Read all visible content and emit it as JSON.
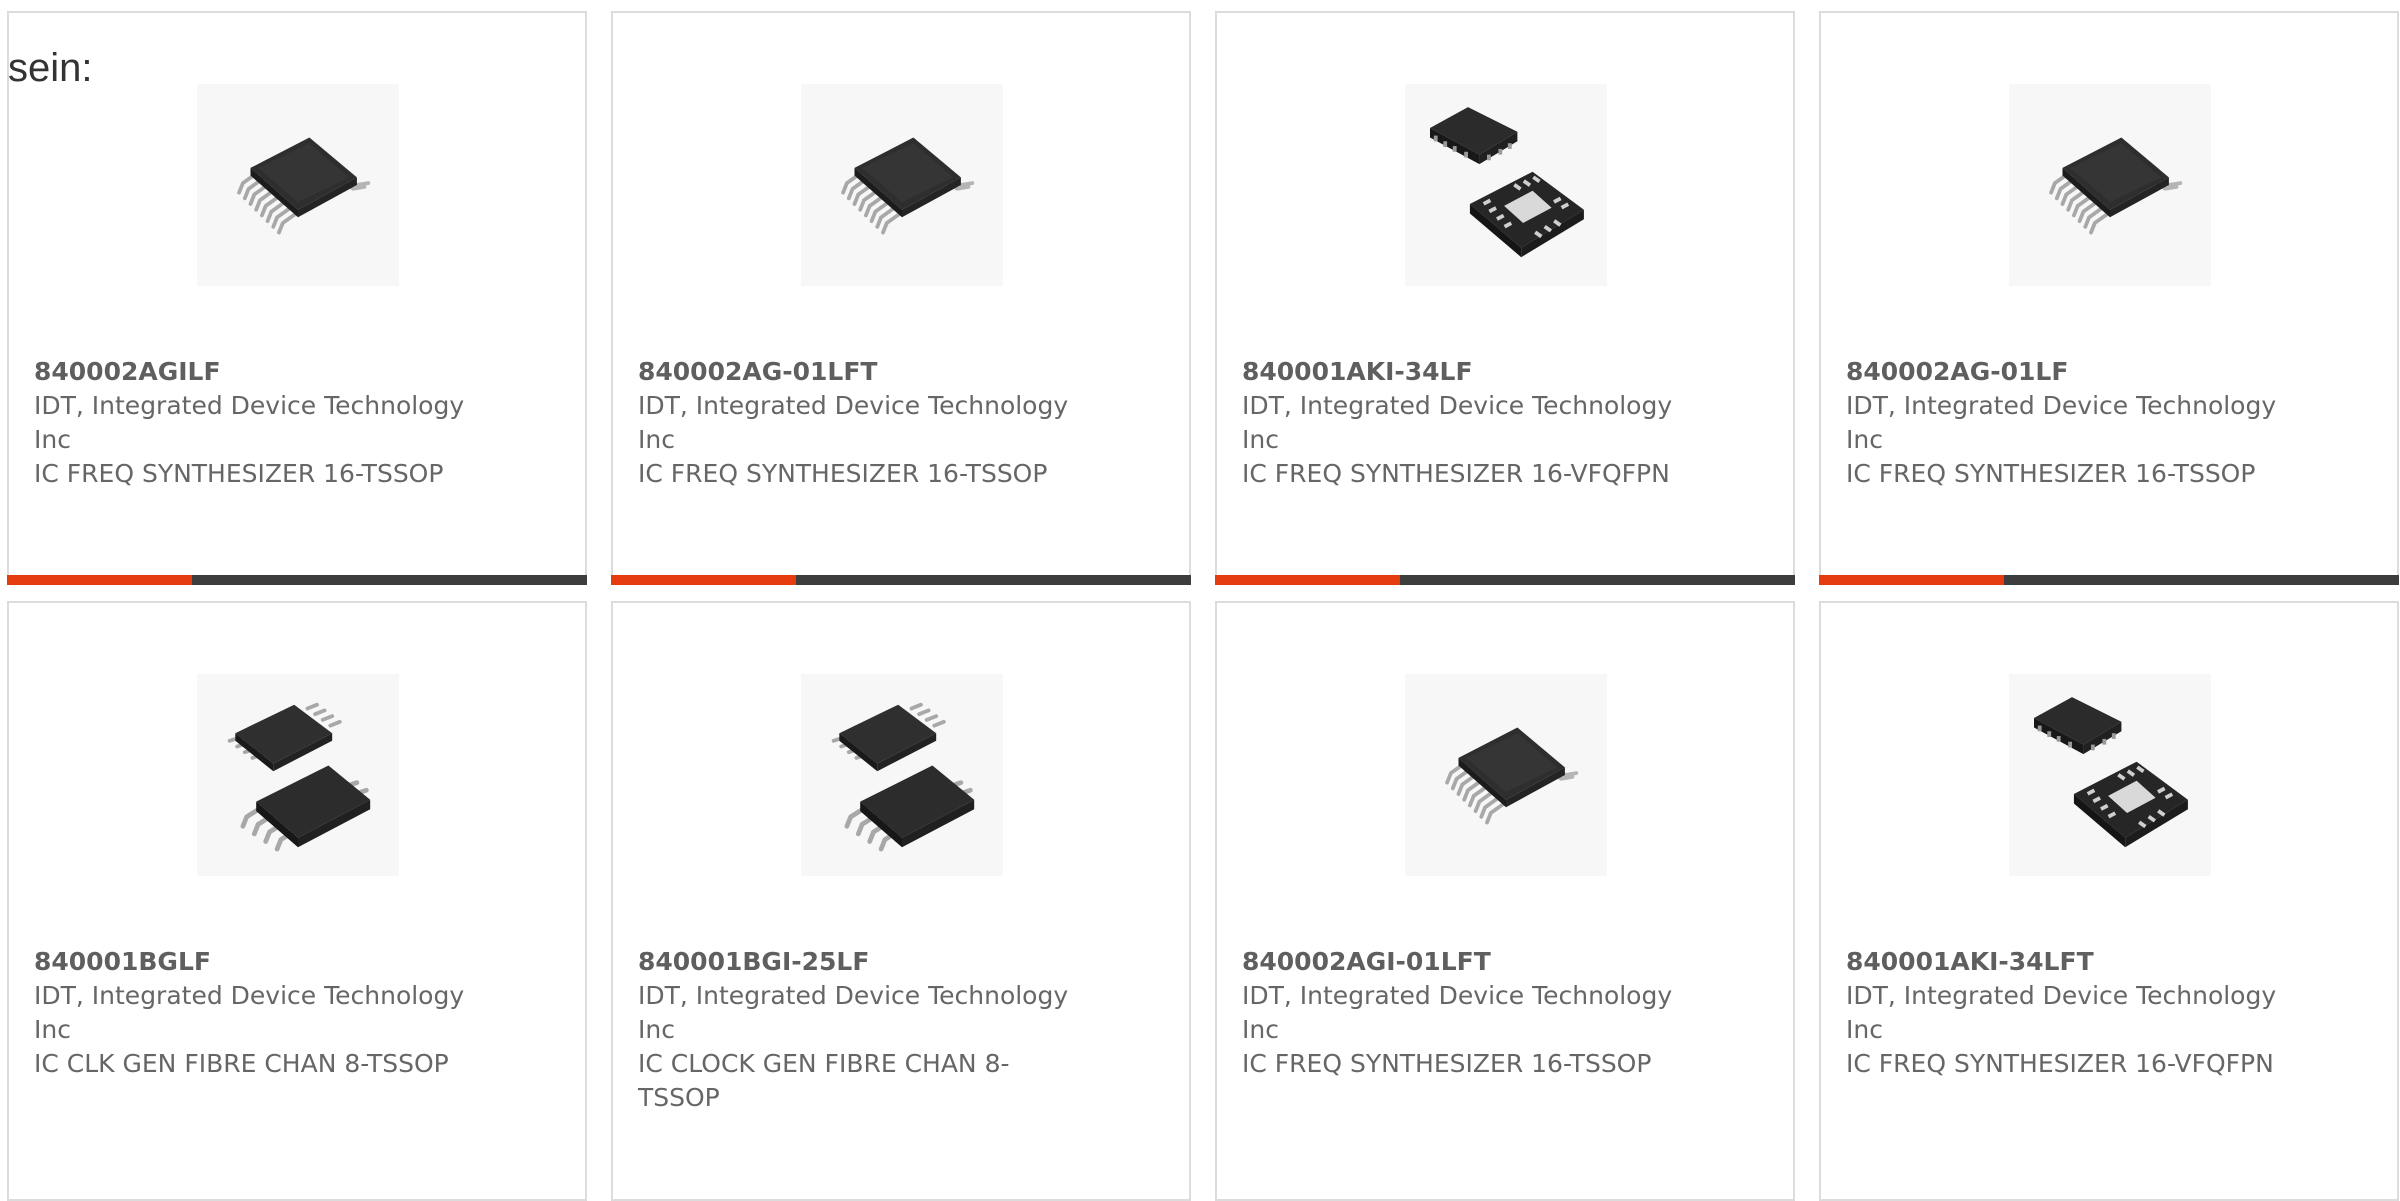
{
  "intro_text": "sein:",
  "products": [
    {
      "part_number": "840002AGILF",
      "manufacturer": "IDT, Integrated Device Technology Inc",
      "description": "IC FREQ SYNTHESIZER 16-TSSOP",
      "image": "tssop-16-package"
    },
    {
      "part_number": "840002AG-01LFT",
      "manufacturer": "IDT, Integrated Device Technology Inc",
      "description": "IC FREQ SYNTHESIZER 16-TSSOP",
      "image": "tssop-16-package"
    },
    {
      "part_number": "840001AKI-34LF",
      "manufacturer": "IDT, Integrated Device Technology Inc",
      "description": "IC FREQ SYNTHESIZER 16-VFQFPN",
      "image": "vfqfpn-16-package"
    },
    {
      "part_number": "840002AG-01LF",
      "manufacturer": "IDT, Integrated Device Technology Inc",
      "description": "IC FREQ SYNTHESIZER 16-TSSOP",
      "image": "tssop-16-package"
    },
    {
      "part_number": "840001BGLF",
      "manufacturer": "IDT, Integrated Device Technology Inc",
      "description": "IC CLK GEN FIBRE CHAN 8-TSSOP",
      "image": "tssop-8-package"
    },
    {
      "part_number": "840001BGI-25LF",
      "manufacturer": "IDT, Integrated Device Technology Inc",
      "description": "IC CLOCK GEN FIBRE CHAN 8-TSSOP",
      "image": "tssop-8-package"
    },
    {
      "part_number": "840002AGI-01LFT",
      "manufacturer": "IDT, Integrated Device Technology Inc",
      "description": "IC FREQ SYNTHESIZER 16-TSSOP",
      "image": "tssop-16-package"
    },
    {
      "part_number": "840001AKI-34LFT",
      "manufacturer": "IDT, Integrated Device Technology Inc",
      "description": "IC FREQ SYNTHESIZER 16-VFQFPN",
      "image": "vfqfpn-16-package"
    }
  ],
  "colors": {
    "accent": "#e43c0e",
    "bar_dark": "#3d3d3d",
    "border": "#dcdcdc",
    "text": "#666666"
  }
}
